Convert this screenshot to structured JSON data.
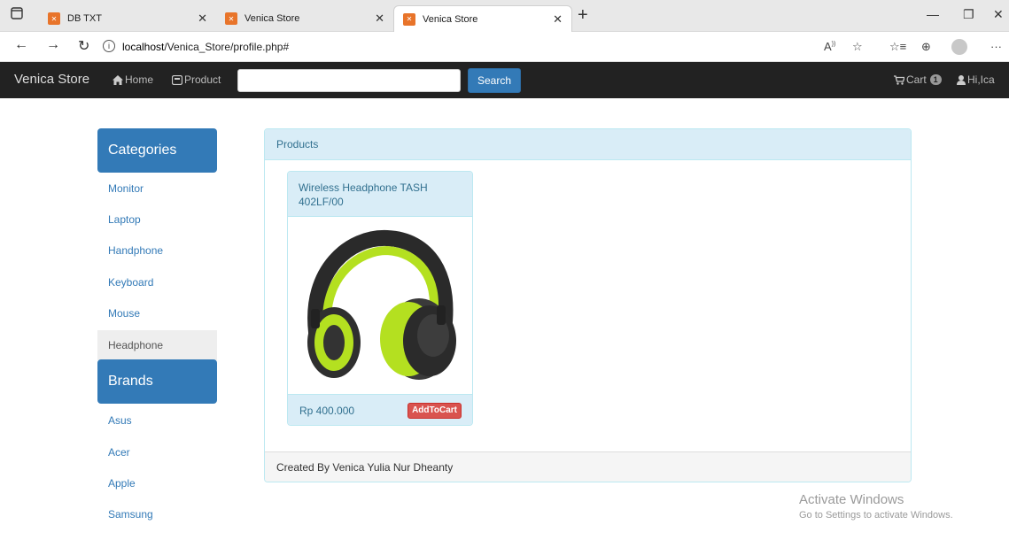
{
  "browser": {
    "tabs": [
      {
        "label": "DB TXT"
      },
      {
        "label": "Venica Store"
      },
      {
        "label": "Venica Store"
      }
    ],
    "url_host": "localhost",
    "url_path": "/Venica_Store/profile.php#"
  },
  "navbar": {
    "brand": "Venica Store",
    "home_label": "Home",
    "product_label": "Product",
    "search_value": "",
    "search_button": "Search",
    "cart_label": "Cart",
    "cart_count": "1",
    "user_label": "Hi,Ica"
  },
  "sidebar": {
    "categories_title": "Categories",
    "categories": [
      "Monitor",
      "Laptop",
      "Handphone",
      "Keyboard",
      "Mouse",
      "Headphone"
    ],
    "brands_title": "Brands",
    "brands": [
      "Asus",
      "Acer",
      "Apple",
      "Samsung"
    ]
  },
  "products": {
    "title": "Products",
    "items": [
      {
        "name": "Wireless Headphone TASH 402LF/00",
        "price": "Rp 400.000",
        "button": "AddToCart"
      }
    ],
    "footer": "Created By Venica Yulia Nur Dheanty"
  },
  "watermark": {
    "line1": "Activate Windows",
    "line2": "Go to Settings to activate Windows."
  }
}
